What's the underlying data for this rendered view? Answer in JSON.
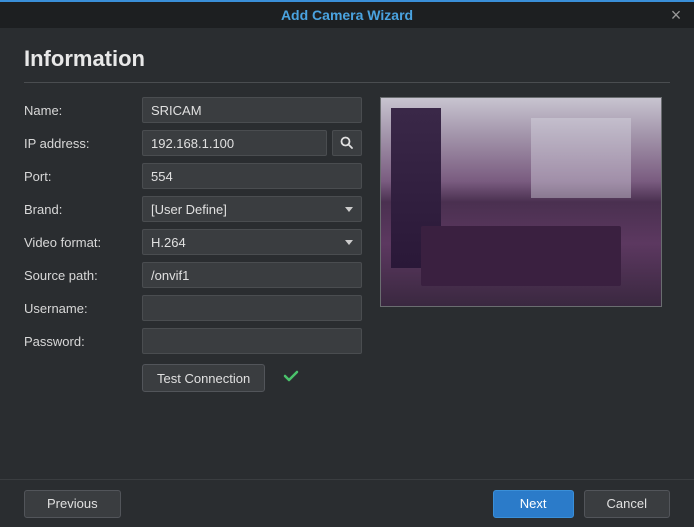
{
  "header": {
    "title": "Add Camera Wizard"
  },
  "section": {
    "heading": "Information"
  },
  "form": {
    "name_label": "Name:",
    "name_value": "SRICAM",
    "ip_label": "IP address:",
    "ip_value": "192.168.1.100",
    "port_label": "Port:",
    "port_value": "554",
    "brand_label": "Brand:",
    "brand_value": "[User Define]",
    "video_label": "Video format:",
    "video_value": "H.264",
    "source_label": "Source path:",
    "source_value": "/onvif1",
    "user_label": "Username:",
    "user_value": "",
    "pass_label": "Password:",
    "pass_value": ""
  },
  "actions": {
    "test": "Test Connection",
    "test_status": "success"
  },
  "footer": {
    "prev": "Previous",
    "next": "Next",
    "cancel": "Cancel"
  }
}
